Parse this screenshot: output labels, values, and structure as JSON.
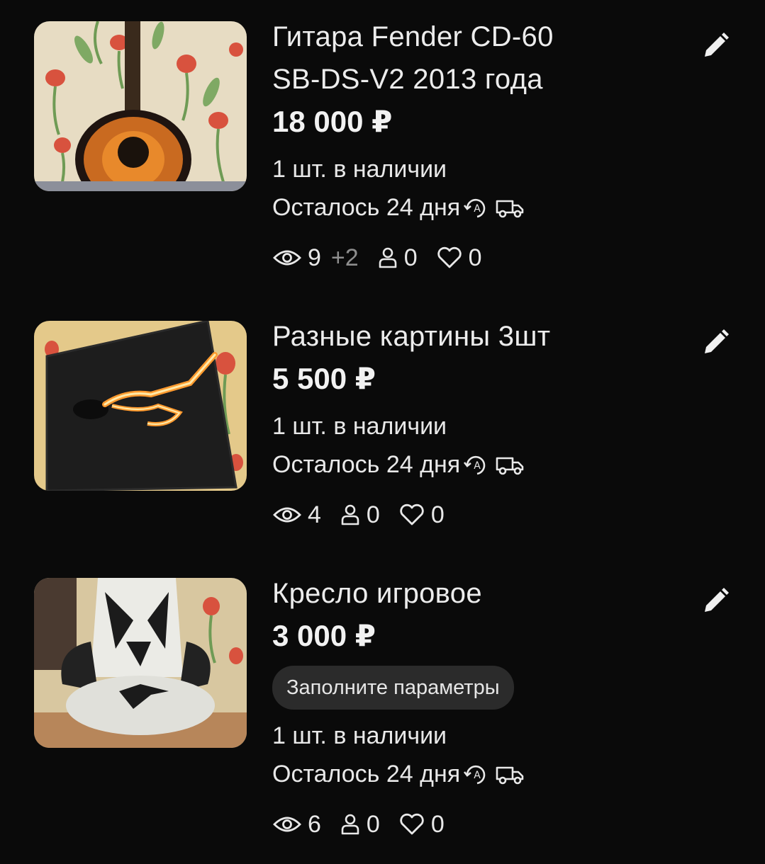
{
  "listings": [
    {
      "title_line1": "Гитара Fender CD-60",
      "title_line2": "SB-DS-V2 2013 года",
      "price": "18 000 ₽",
      "quantity": "1 шт. в наличии",
      "days_left": "Осталось 24 дня",
      "views": "9",
      "views_extra": "+2",
      "contacts": "0",
      "favorites": "0",
      "photo": "guitar"
    },
    {
      "title_line1": "Разные картины 3шт",
      "price": "5 500 ₽",
      "quantity": "1 шт. в наличии",
      "days_left": "Осталось 24 дня",
      "views": "4",
      "contacts": "0",
      "favorites": "0",
      "photo": "neon-painting"
    },
    {
      "title_line1": "Кресло игровое",
      "price": "3 000 ₽",
      "badge": "Заполните параметры",
      "quantity": "1 шт. в наличии",
      "days_left": "Осталось 24 дня",
      "views": "6",
      "contacts": "0",
      "favorites": "0",
      "photo": "gaming-chair"
    }
  ],
  "icons": {
    "edit": "pencil-icon",
    "auto_renew": "auto-renew-icon",
    "delivery": "delivery-truck-icon",
    "views": "eye-icon",
    "contacts": "person-icon",
    "favorites": "heart-icon"
  },
  "colors": {
    "background": "#0a0a0a",
    "text": "#ececec",
    "muted": "#8e8e8e",
    "badge_bg": "#2b2b2b"
  }
}
